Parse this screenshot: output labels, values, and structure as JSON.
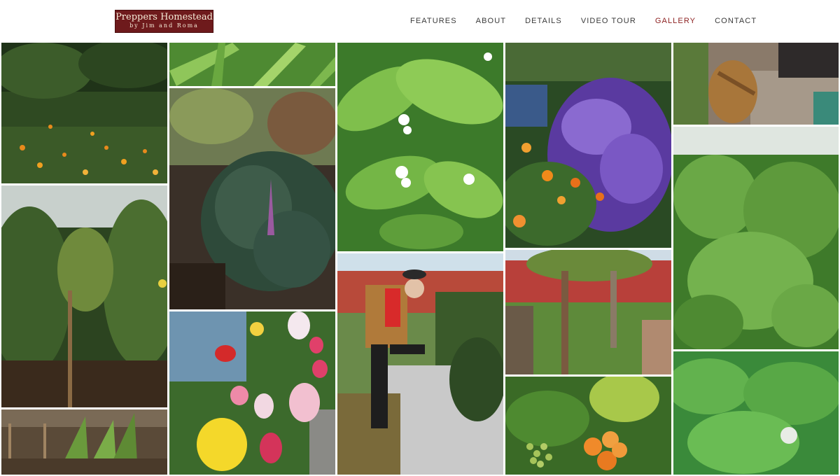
{
  "brand": {
    "title": "Preppers Homestead",
    "subtitle": "by Jim and Roma"
  },
  "nav": {
    "features": "FEATURES",
    "about": "ABOUT",
    "details": "DETAILS",
    "video_tour": "VIDEO TOUR",
    "gallery": "GALLERY",
    "contact": "CONTACT",
    "active": "GALLERY"
  },
  "colors": {
    "brand_red": "#6e1a1c",
    "active_nav": "#8c1f1f",
    "nav_text": "#3a3a3a"
  }
}
